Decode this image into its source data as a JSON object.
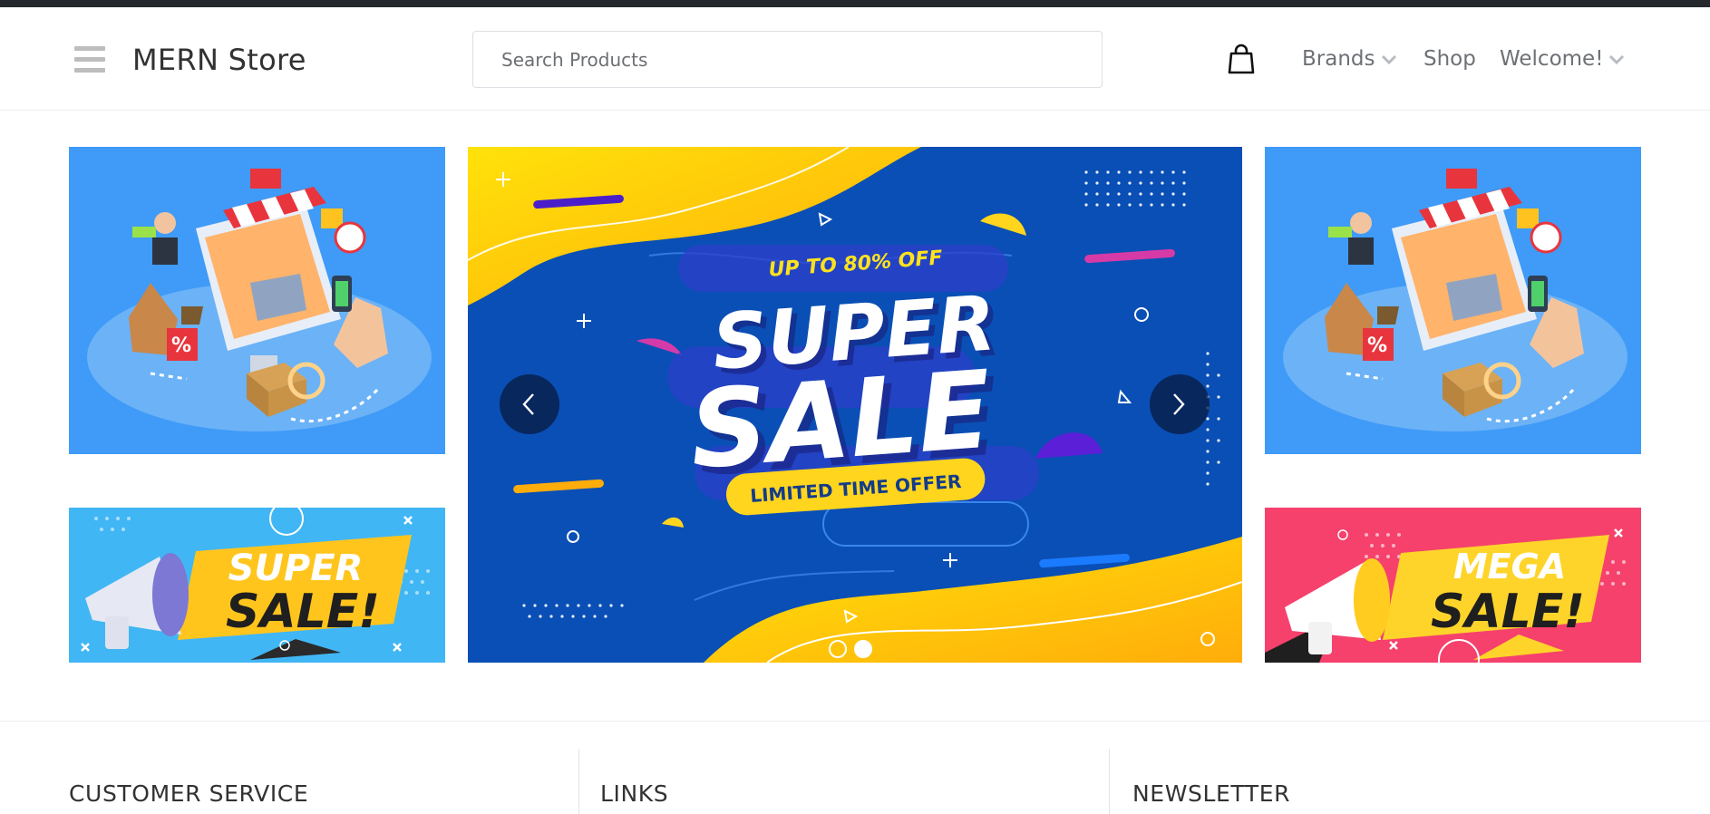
{
  "header": {
    "brand": "MERN Store",
    "menu_icon": "hamburger-menu-icon",
    "cart_icon": "shopping-bag-icon",
    "nav": [
      {
        "label": "Brands",
        "has_dropdown": true
      },
      {
        "label": "Shop",
        "has_dropdown": false
      },
      {
        "label": "Welcome!",
        "has_dropdown": true
      }
    ]
  },
  "search": {
    "placeholder": "Search Products",
    "value": ""
  },
  "hero": {
    "left_top_image": "online-store-isometric-illustration",
    "left_bottom_banner": {
      "line1": "SUPER",
      "line2": "SALE!"
    },
    "carousel": {
      "tagline": "UP TO 80% OFF",
      "headline_1": "SUPER",
      "headline_2": "SALE",
      "badge": "LIMITED TIME OFFER",
      "prev_icon": "chevron-left-icon",
      "next_icon": "chevron-right-icon",
      "slide_count": 2,
      "active_slide": 2
    },
    "right_top_image": "online-store-isometric-illustration",
    "right_bottom_banner": {
      "line1": "MEGA",
      "line2": "SALE!"
    }
  },
  "footer": {
    "columns": [
      {
        "title": "CUSTOMER SERVICE"
      },
      {
        "title": "LINKS"
      },
      {
        "title": "NEWSLETTER"
      }
    ]
  },
  "colors": {
    "topstrip": "#25282c",
    "hero_blue": "#0a4fb5",
    "hero_yellow": "#ffc20e",
    "side_blue": "#3f9bf7",
    "pink": "#f5416c"
  }
}
